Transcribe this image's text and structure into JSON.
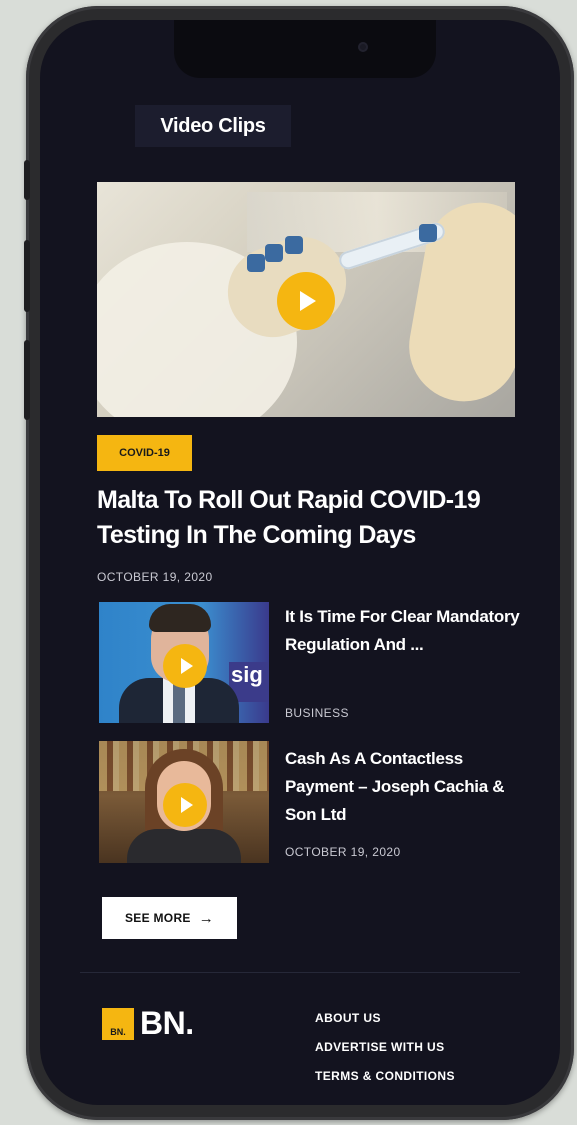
{
  "section": {
    "title": "Video Clips"
  },
  "featured": {
    "category": "COVID-19",
    "title": "Malta To Roll Out Rapid COVID-19 Testing In The Coming Days",
    "date": "OCTOBER 19, 2020"
  },
  "items": [
    {
      "title": "It Is Time For Clear Mandatory Regulation And ...",
      "meta": "BUSINESS",
      "thumb_sign": "sig"
    },
    {
      "title": "Cash As A Contactless Payment – Joseph Cachia & Son Ltd",
      "meta": "OCTOBER 19, 2020"
    }
  ],
  "see_more": {
    "label": "SEE MORE",
    "arrow": "→"
  },
  "footer": {
    "logo_mark": "BN.",
    "logo_text": "BN.",
    "links": [
      "ABOUT US",
      "ADVERTISE WITH US",
      "TERMS & CONDITIONS"
    ]
  },
  "colors": {
    "accent": "#f5b611",
    "background": "#13131f",
    "text": "#ffffff"
  }
}
